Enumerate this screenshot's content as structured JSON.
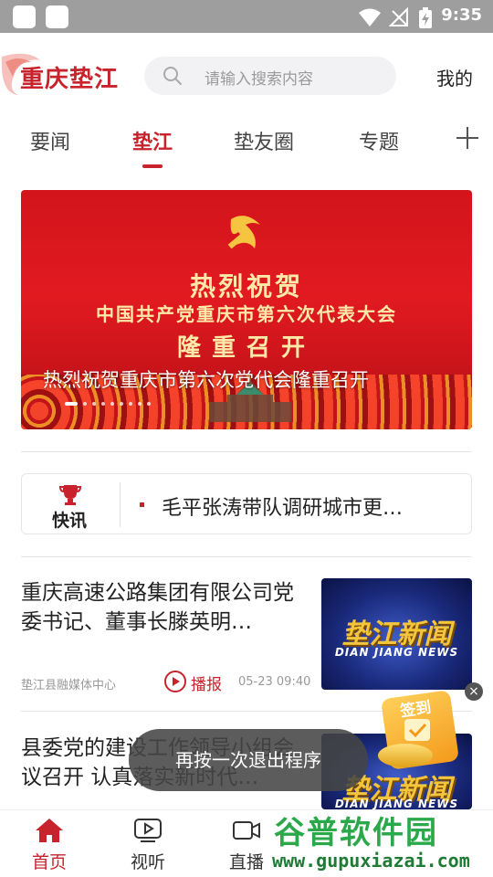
{
  "status_bar": {
    "time": "9:35"
  },
  "header": {
    "logo_text": "重庆垫江",
    "search_placeholder": "请输入搜索内容",
    "mine_label": "我的"
  },
  "tabs": [
    {
      "label": "要闻",
      "active": false
    },
    {
      "label": "垫江",
      "active": true
    },
    {
      "label": "垫友圈",
      "active": false
    },
    {
      "label": "专题",
      "active": false
    }
  ],
  "banner": {
    "line1": "热烈祝贺",
    "line2": "中国共产党重庆市第六次代表大会",
    "line3": "隆重召开",
    "caption": "热烈祝贺重庆市第六次党代会隆重召开",
    "dot_count": 9,
    "active_dot": 0
  },
  "flash_news": {
    "label": "快讯",
    "text": "毛平张涛带队调研城市更…"
  },
  "news": [
    {
      "title": "重庆高速公路集团有限公司党委书记、董事长滕英明…",
      "source": "垫江县融媒体中心",
      "play_label": "播报",
      "time": "05-23 09:40",
      "thumb_title": "垫江新闻",
      "thumb_sub": "DIAN JIANG NEWS"
    },
    {
      "title": "县委党的建设工作领导小组会议召开 认真落实新时代…",
      "thumb_title": "垫江新闻",
      "thumb_sub": "DIAN JIANG NEWS"
    }
  ],
  "toast": "再按一次退出程序",
  "sign_in": {
    "label": "签到",
    "close": "×"
  },
  "bottom_nav": [
    {
      "label": "首页",
      "icon": "home-icon",
      "active": true
    },
    {
      "label": "视听",
      "icon": "video-play-icon",
      "active": false
    },
    {
      "label": "直播",
      "icon": "camera-icon",
      "active": false
    }
  ],
  "watermark": {
    "title": "谷普软件园",
    "url": "www.gupuxiazai.com"
  },
  "colors": {
    "accent": "#c8232c",
    "status_bar": "#9e9e9e",
    "watermark": "#2aa84a"
  }
}
